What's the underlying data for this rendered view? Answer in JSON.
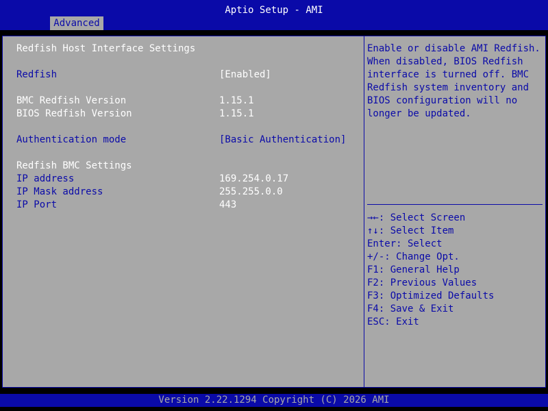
{
  "header": {
    "title": "Aptio Setup - AMI",
    "tab": "Advanced"
  },
  "main": {
    "section_title": "Redfish Host Interface Settings",
    "redfish": {
      "label": "Redfish",
      "value": "[Enabled]"
    },
    "bmc_version": {
      "label": "BMC Redfish Version",
      "value": "1.15.1"
    },
    "bios_version": {
      "label": "BIOS Redfish Version",
      "value": "1.15.1"
    },
    "auth_mode": {
      "label": "Authentication mode",
      "value": "[Basic Authentication]"
    },
    "bmc_settings_title": "Redfish BMC Settings",
    "ip_address": {
      "label": "IP address",
      "value": "169.254.0.17"
    },
    "ip_mask": {
      "label": "IP Mask address",
      "value": "255.255.0.0"
    },
    "ip_port": {
      "label": "IP Port",
      "value": "443"
    }
  },
  "help": {
    "lines": [
      "Enable or disable AMI Redfish.",
      "When disabled, BIOS Redfish",
      "interface is turned off. BMC",
      "Redfish system inventory and",
      "BIOS configuration will no",
      "longer be updated."
    ]
  },
  "keys": [
    "→←: Select Screen",
    "↑↓: Select Item",
    "Enter: Select",
    "+/-: Change Opt.",
    "F1: General Help",
    "F2: Previous Values",
    "F3: Optimized Defaults",
    "F4: Save & Exit",
    "ESC: Exit"
  ],
  "footer": {
    "text": "Version 2.22.1294 Copyright (C) 2026 AMI"
  },
  "colors": {
    "bios_blue": "#0a0aa8",
    "bios_gray": "#a8a8a8",
    "white": "#ffffff"
  }
}
